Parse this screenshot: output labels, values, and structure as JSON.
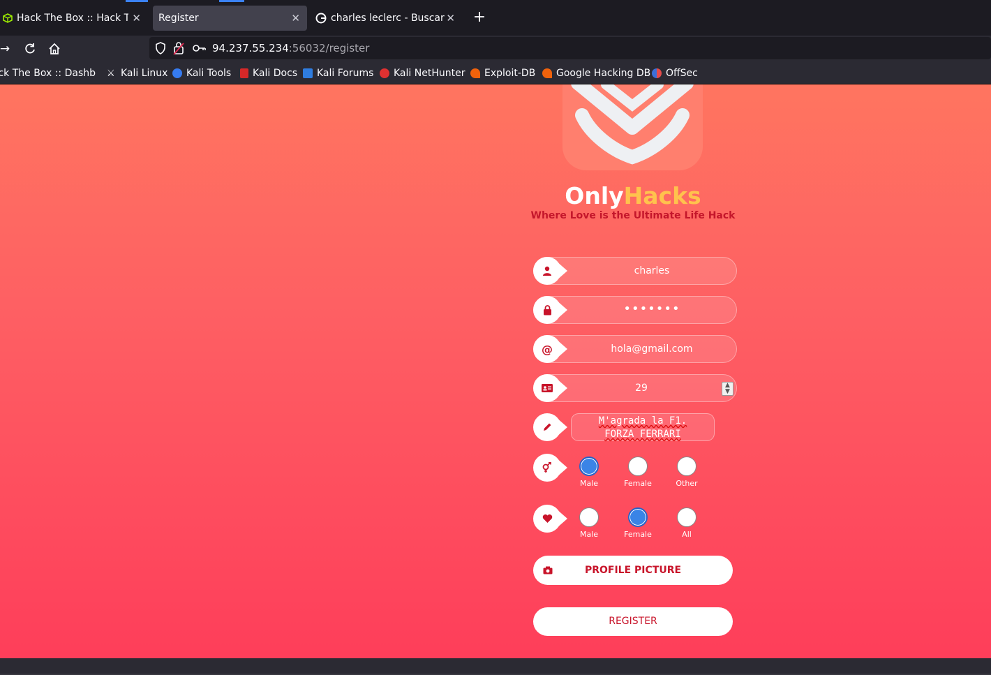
{
  "browser": {
    "tabs": [
      {
        "title": "Hack The Box :: Hack The Box",
        "active": false,
        "favicon": "htb-cube-icon"
      },
      {
        "title": "Register",
        "active": true,
        "favicon": ""
      },
      {
        "title": "charles leclerc - Buscar con Google",
        "active": false,
        "favicon": "google-icon"
      }
    ],
    "new_tab_label": "+",
    "url": {
      "host": "94.237.55.234",
      "rest": ":56032/register"
    },
    "bookmarks": [
      {
        "label": "Hack The Box :: Dashb…",
        "icon": "htb-icon"
      },
      {
        "label": "Kali Linux",
        "icon": "kali-dragon-icon"
      },
      {
        "label": "Kali Tools",
        "icon": "kali-tools-icon"
      },
      {
        "label": "Kali Docs",
        "icon": "kali-docs-icon"
      },
      {
        "label": "Kali Forums",
        "icon": "kali-forums-icon"
      },
      {
        "label": "Kali NetHunter",
        "icon": "nethunter-icon"
      },
      {
        "label": "Exploit-DB",
        "icon": "exploitdb-icon"
      },
      {
        "label": "Google Hacking DB",
        "icon": "ghdb-icon"
      },
      {
        "label": "OffSec",
        "icon": "offsec-icon"
      }
    ]
  },
  "page": {
    "brand_white": "Only",
    "brand_yellow": "Hacks",
    "tagline": "Where Love is the Ultimate Life Hack",
    "form": {
      "username": "charles",
      "password_masked": "•••••••",
      "email": "hola@gmail.com",
      "age": "29",
      "bio_line1": "M'agrada la F1.",
      "bio_line2": "FORZA FERRARI",
      "gender_options": [
        "Male",
        "Female",
        "Other"
      ],
      "gender_selected": "Male",
      "interest_options": [
        "Male",
        "Female",
        "All"
      ],
      "interest_selected": "Female",
      "profile_picture_label": "PROFILE PICTURE",
      "register_label": "REGISTER"
    }
  },
  "colors": {
    "gradient_top": "#ff7560",
    "gradient_bottom": "#fe3e5a",
    "accent_red": "#c8142a",
    "brand_yellow": "#ffc24d",
    "radio_selected": "#3a84e6"
  }
}
